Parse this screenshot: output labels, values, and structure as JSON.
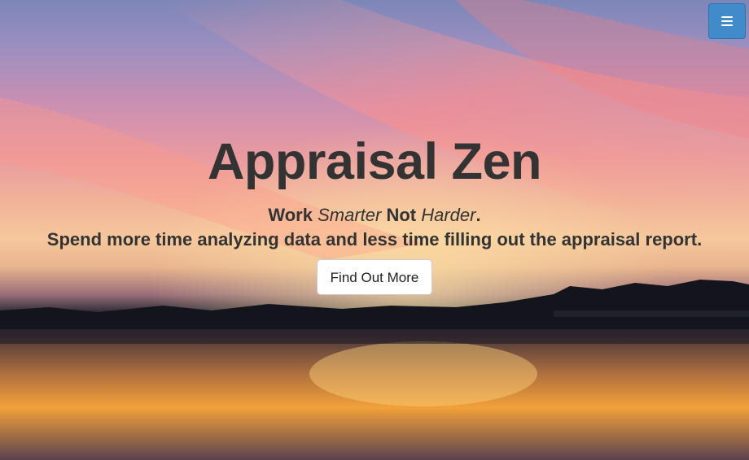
{
  "navbar": {
    "menu_icon": "hamburger-icon",
    "menu_button_color": "#428bca"
  },
  "hero": {
    "title": "Appraisal Zen",
    "tagline": {
      "part1": "Work ",
      "part2": "Smarter",
      "part3": " Not ",
      "part4": "Harder",
      "part5": "."
    },
    "subtext": "Spend more time analyzing data and less time filling out the appraisal report.",
    "cta_label": "Find Out More",
    "background_image": "sunset-over-lake-photo"
  }
}
